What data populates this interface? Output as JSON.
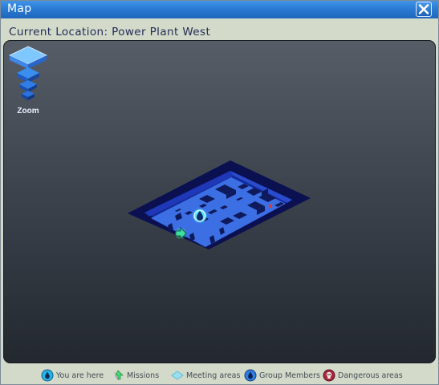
{
  "window": {
    "title": "Map",
    "close_label": "X"
  },
  "location": {
    "text": "Current Location: Power Plant West"
  },
  "zoom": {
    "label": "Zoom"
  },
  "legend": {
    "items": [
      {
        "label": "You are here",
        "icon": "you-are-here-icon",
        "color": "#25b4e8"
      },
      {
        "label": "Missions",
        "icon": "missions-icon",
        "color": "#8a3bd6"
      },
      {
        "label": "Meeting areas",
        "icon": "meeting-areas-icon",
        "color": "#58c0d8"
      },
      {
        "label": "Group Members",
        "icon": "group-members-icon",
        "color": "#2f7ee0"
      },
      {
        "label": "Dangerous areas",
        "icon": "dangerous-areas-icon",
        "color": "#a8283c"
      }
    ]
  },
  "colors": {
    "titlebar": "#2a7bd4",
    "map_floor": "#3c6fe4",
    "map_wall": "#0a1050",
    "player_marker": "#36d8f0",
    "hazard_dot": "#e03a2a",
    "mission_arrow": "#3ee0a0"
  }
}
